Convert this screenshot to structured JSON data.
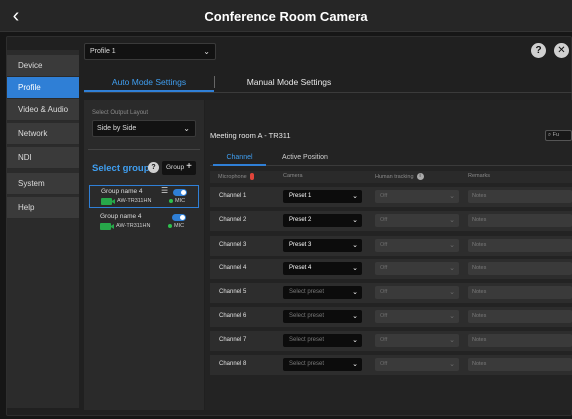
{
  "title": "Conference Room Camera",
  "sidebar": {
    "items": [
      {
        "label": "Device"
      },
      {
        "label": "Profile"
      },
      {
        "label": "Video & Audio"
      },
      {
        "label": "Network"
      },
      {
        "label": "NDI"
      },
      {
        "label": "System"
      },
      {
        "label": "Help"
      }
    ],
    "active_index": 1
  },
  "profile_select": {
    "value": "Profile 1"
  },
  "header_buttons": {
    "help": "?",
    "close": "✕"
  },
  "mode_tabs": {
    "auto": "Auto Mode Settings",
    "manual": "Manual Mode Settings"
  },
  "left_panel": {
    "output_layout_label": "Select Output Layout",
    "output_layout_value": "Side by Side",
    "select_group_label": "Select group",
    "group_button_label": "Group",
    "groups": [
      {
        "name": "Group name 4",
        "model": "AW-TR311HN",
        "mic": "MIC",
        "selected": true
      },
      {
        "name": "Group name 4",
        "model": "AW-TR311HN",
        "mic": "MIC",
        "selected": false
      }
    ]
  },
  "right_panel": {
    "room_title": "Meeting room A - TR311",
    "search_placeholder": "Fu",
    "tabs": {
      "channel": "Channel",
      "position": "Active Position"
    },
    "columns": {
      "microphone": "Microphone",
      "camera": "Camera",
      "tracking": "Human tracking",
      "remarks": "Remarks"
    },
    "rows": [
      {
        "channel": "Channel 1",
        "camera": "Preset 1",
        "tracking": "Off",
        "notes": "Notes"
      },
      {
        "channel": "Channel 2",
        "camera": "Preset 2",
        "tracking": "Off",
        "notes": "Notes"
      },
      {
        "channel": "Channel 3",
        "camera": "Preset 3",
        "tracking": "Off",
        "notes": "Notes"
      },
      {
        "channel": "Channel 4",
        "camera": "Preset 4",
        "tracking": "Off",
        "notes": "Notes"
      },
      {
        "channel": "Channel 5",
        "camera": "Select preset",
        "tracking": "Off",
        "notes": "Notes"
      },
      {
        "channel": "Channel 6",
        "camera": "Select preset",
        "tracking": "Off",
        "notes": "Notes"
      },
      {
        "channel": "Channel 7",
        "camera": "Select preset",
        "tracking": "Off",
        "notes": "Notes"
      },
      {
        "channel": "Channel 8",
        "camera": "Select preset",
        "tracking": "Off",
        "notes": "Notes"
      }
    ]
  },
  "colors": {
    "accent": "#2f7fd6",
    "mic_status": "#2ec14e",
    "camera_icon": "#27a84a",
    "mic_icon": "#e0443a"
  }
}
